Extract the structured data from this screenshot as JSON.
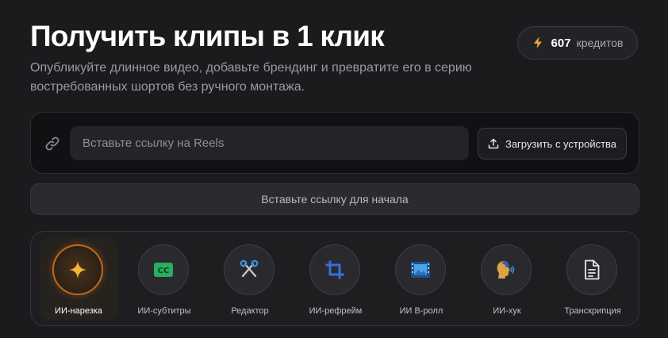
{
  "header": {
    "title": "Получить клипы в 1 клик",
    "subtitle": "Опубликуйте длинное видео, добавьте брендинг и превратите его в серию востребованных шортов без ручного монтажа."
  },
  "credits": {
    "icon": "lightning-bolt-icon",
    "count": "607",
    "label": "кредитов"
  },
  "url_form": {
    "link_icon": "link-icon",
    "input_placeholder": "Вставьте ссылку на Reels",
    "input_value": "",
    "upload_icon": "upload-icon",
    "upload_label": "Загрузить с устройства"
  },
  "start_button": {
    "label": "Вставьте ссылку для начала"
  },
  "tools": [
    {
      "label": "ИИ-нарезка",
      "icon": "sparkle-icon",
      "active": true
    },
    {
      "label": "ИИ-субтитры",
      "icon": "closed-captions-icon",
      "active": false
    },
    {
      "label": "Редактор",
      "icon": "scissors-icon",
      "active": false
    },
    {
      "label": "ИИ-рефрейм",
      "icon": "crop-frame-icon",
      "active": false
    },
    {
      "label": "ИИ B-ролл",
      "icon": "film-clip-icon",
      "active": false
    },
    {
      "label": "ИИ-хук",
      "icon": "speaking-head-icon",
      "active": false
    },
    {
      "label": "Транскрипция",
      "icon": "document-icon",
      "active": false
    }
  ],
  "colors": {
    "background": "#1b1b1e",
    "accent_orange": "#f0a533",
    "active_ring": "#c06a18",
    "caption_green": "#2ecc71",
    "frame_blue": "#3a6fe0"
  }
}
